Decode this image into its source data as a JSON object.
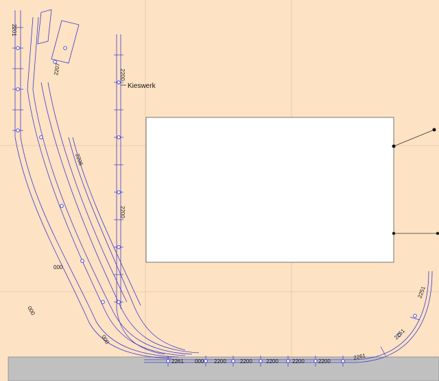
{
  "layout": {
    "name": "track-plan",
    "background_color": "#fde2c4",
    "grid_color": "#e8c8a8",
    "track_color": "#3a3acc",
    "platform_color": "#c0c0c0",
    "panel_color": "#ffffff"
  },
  "labels": {
    "kieswerk": "Kieswerk",
    "left_zero_a": "000",
    "left_zero_b": "000",
    "bottom_zero": "000"
  },
  "track_codes": {
    "c2200": "2200",
    "c2201": "2201",
    "c2207": "2207",
    "c2200b": "2200",
    "c2261": "2261",
    "c2251": "2251",
    "c2206": "2206",
    "c2261b": "2261",
    "c000": "000"
  }
}
